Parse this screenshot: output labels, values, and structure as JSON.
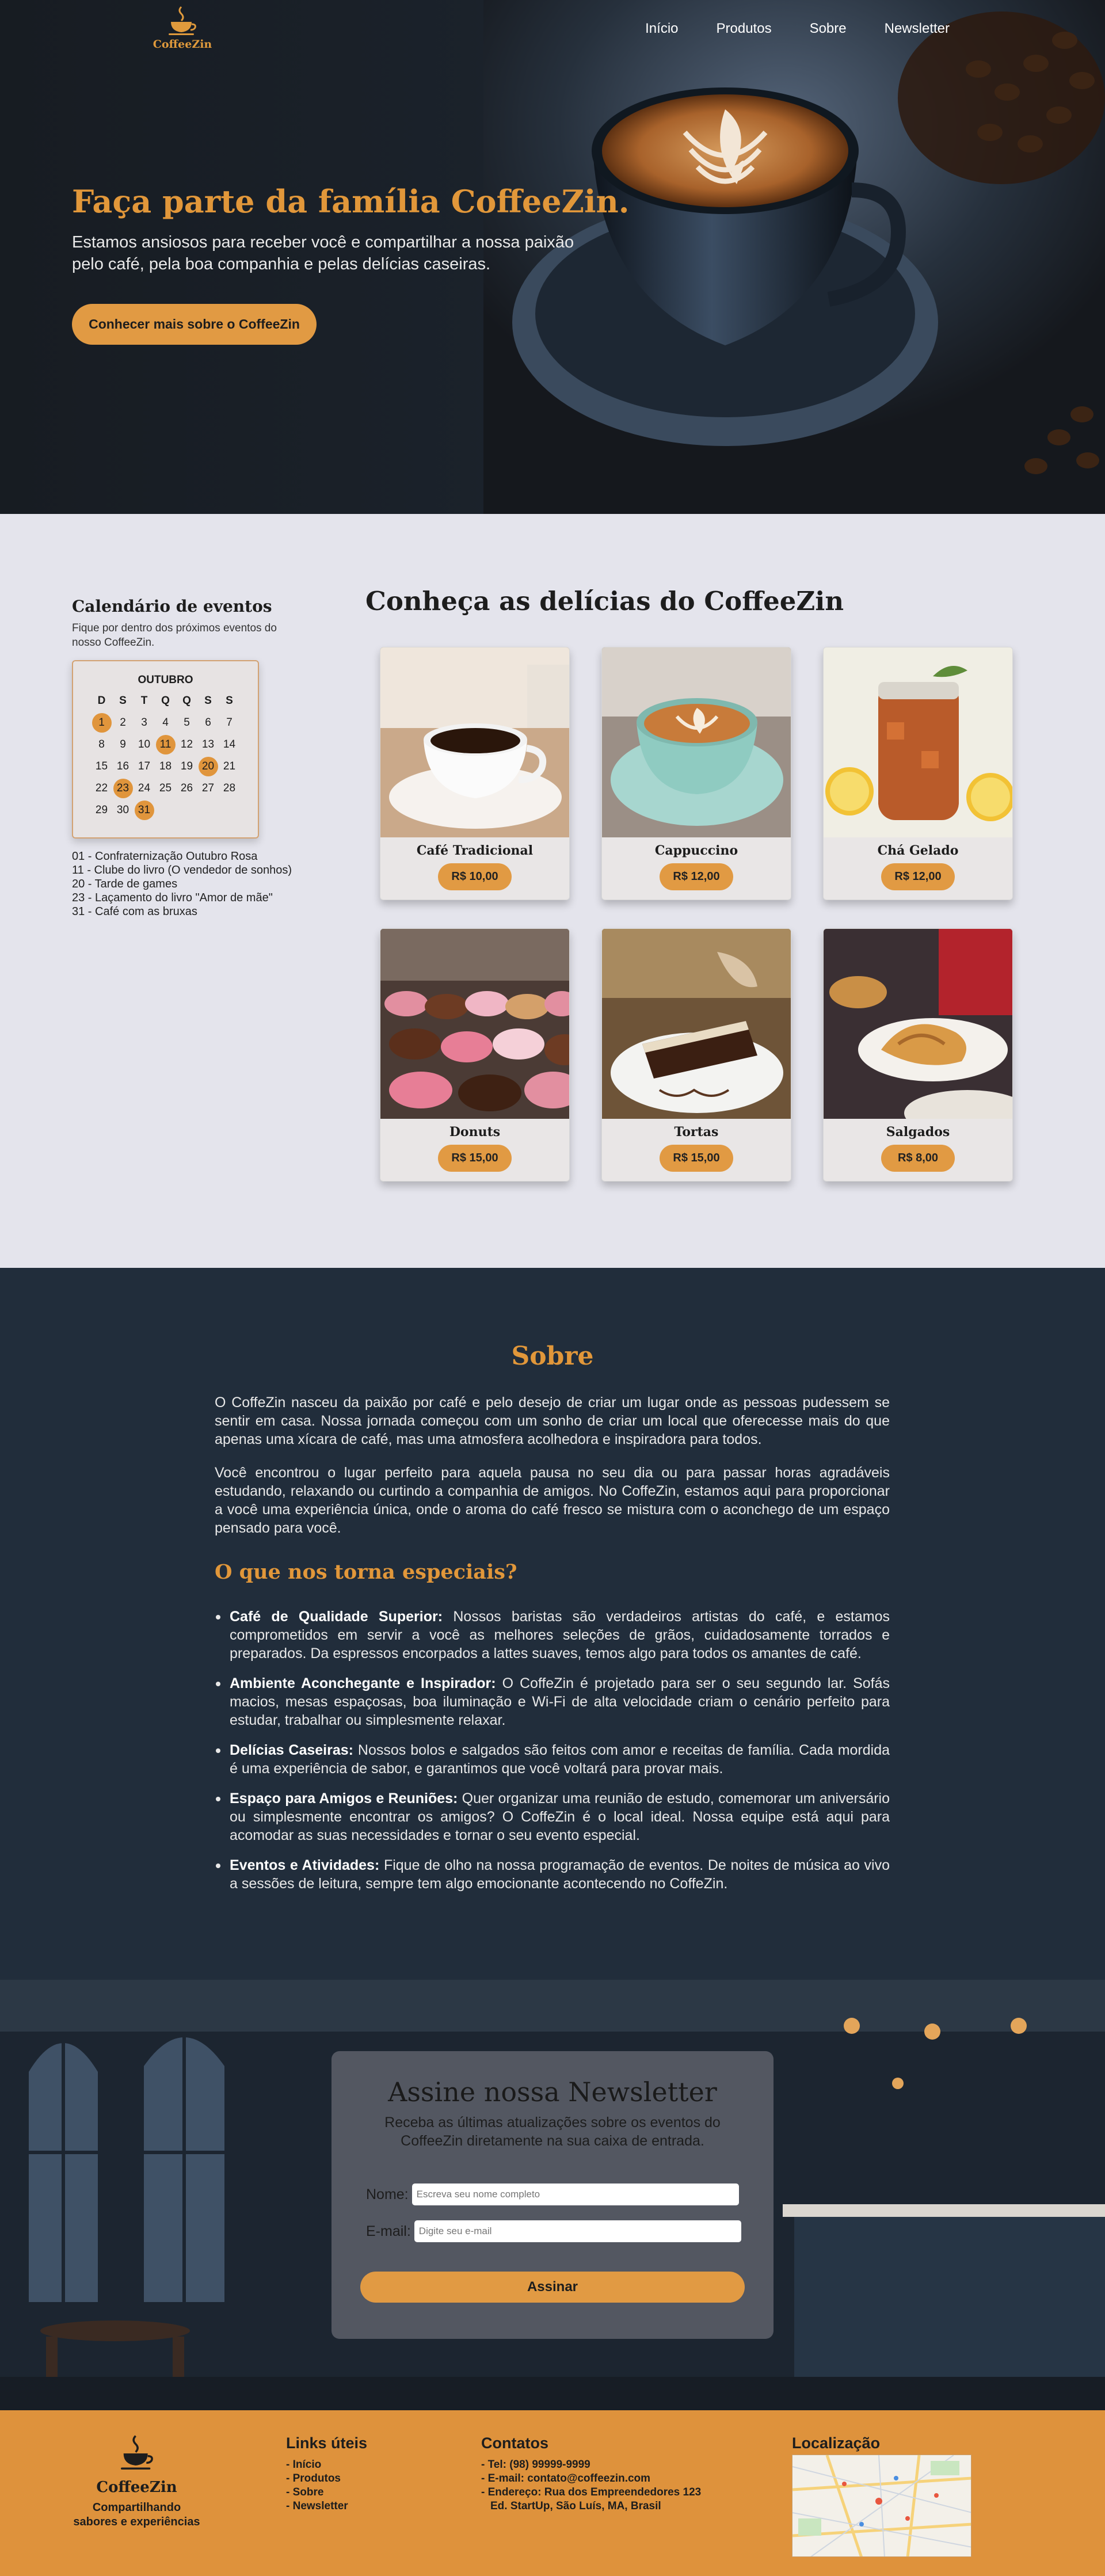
{
  "nav": {
    "brand": "CoffeeZin",
    "links": [
      "Início",
      "Produtos",
      "Sobre",
      "Newsletter"
    ]
  },
  "hero": {
    "title": "Faça parte da família CoffeeZin.",
    "subtitle": "Estamos ansiosos para receber você e compartilhar a nossa paixão pelo café, pela boa companhia e pelas delícias caseiras.",
    "button": "Conhecer mais sobre o CoffeeZin"
  },
  "calendar": {
    "title": "Calendário de eventos",
    "subtitle": "Fique por dentro dos próximos eventos do nosso CoffeeZin.",
    "month": "OUTUBRO",
    "weekdays": [
      "D",
      "S",
      "T",
      "Q",
      "Q",
      "S",
      "S"
    ],
    "days": [
      1,
      2,
      3,
      4,
      5,
      6,
      7,
      8,
      9,
      10,
      11,
      12,
      13,
      14,
      15,
      16,
      17,
      18,
      19,
      20,
      21,
      22,
      23,
      24,
      25,
      26,
      27,
      28,
      29,
      30,
      31
    ],
    "highlighted": [
      1,
      11,
      20,
      23,
      31
    ],
    "events": [
      "01 - Confraternização Outubro Rosa",
      "11 - Clube do livro (O vendedor de sonhos)",
      "20 - Tarde de games",
      "23 - Laçamento do livro \"Amor de mãe\"",
      "31 - Café com as bruxas"
    ]
  },
  "menu": {
    "title": "Conheça as delícias do CoffeeZin",
    "items": [
      {
        "name": "Café Tradicional",
        "price": "R$ 10,00"
      },
      {
        "name": "Cappuccino",
        "price": "R$ 12,00"
      },
      {
        "name": "Chá Gelado",
        "price": "R$ 12,00"
      },
      {
        "name": "Donuts",
        "price": "R$ 15,00"
      },
      {
        "name": "Tortas",
        "price": "R$ 15,00"
      },
      {
        "name": "Salgados",
        "price": "R$ 8,00"
      }
    ]
  },
  "about": {
    "title": "Sobre",
    "p1": "O CoffeZin nasceu da paixão por café e pelo desejo de criar um lugar onde as pessoas pudessem se sentir em casa. Nossa jornada começou com um sonho de criar um local que oferecesse mais do que apenas uma xícara de café, mas uma atmosfera acolhedora e inspiradora para todos.",
    "p2": "Você encontrou o lugar perfeito para aquela pausa no seu dia ou para passar horas agradáveis estudando, relaxando ou curtindo a companhia de amigos. No CoffeZin, estamos aqui para proporcionar a você uma experiência única, onde o aroma do café fresco se mistura com o aconchego de um espaço pensado para você.",
    "subtitle": "O que nos torna especiais?",
    "features": [
      {
        "title": "Café de Qualidade Superior:",
        "text": "Nossos baristas são verdadeiros artistas do café, e estamos comprometidos em servir a você as melhores seleções de grãos, cuidadosamente torrados e preparados. Da espressos encorpados a lattes suaves, temos algo para todos os amantes de café."
      },
      {
        "title": "Ambiente Aconchegante e Inspirador:",
        "text": "O CoffeZin é projetado para ser o seu segundo lar. Sofás macios, mesas espaçosas, boa iluminação e Wi-Fi de alta velocidade criam o cenário perfeito para estudar, trabalhar ou simplesmente relaxar."
      },
      {
        "title": "Delícias Caseiras:",
        "text": "Nossos bolos e salgados são feitos com amor e receitas de família. Cada mordida é uma experiência de sabor, e garantimos que você voltará para provar mais."
      },
      {
        "title": "Espaço para Amigos e Reuniões:",
        "text": "Quer organizar uma reunião de estudo, comemorar um aniversário ou simplesmente encontrar os amigos? O CoffeZin é o local ideal. Nossa equipe está aqui para acomodar as suas necessidades e tornar o seu evento especial."
      },
      {
        "title": "Eventos e Atividades:",
        "text": "Fique de olho na nossa programação de eventos. De noites de música ao vivo a sessões de leitura, sempre tem algo emocionante acontecendo no CoffeZin."
      }
    ]
  },
  "newsletter": {
    "title": "Assine nossa Newsletter",
    "subtitle": "Receba as últimas atualizações sobre os eventos do CoffeeZin diretamente na sua caixa de entrada.",
    "name_label": "Nome:",
    "name_placeholder": "Escreva seu nome completo",
    "email_label": "E-mail:",
    "email_placeholder": "Digite seu e-mail",
    "button": "Assinar"
  },
  "footer": {
    "brand": "CoffeeZin",
    "tagline": "Compartilhando sabores e experiências",
    "links_title": "Links úteis",
    "links": [
      "- Início",
      "- Produtos",
      "- Sobre",
      "- Newsletter"
    ],
    "contacts_title": "Contatos",
    "contacts": [
      "- Tel: (98) 99999-9999",
      "- E-mail: contato@coffeezin.com",
      "- Endereço: Rua dos Empreendedores 123",
      "Ed. StartUp, São Luís, MA, Brasil"
    ],
    "location_title": "Localização"
  },
  "colors": {
    "accent": "#e19a43",
    "dark": "#212d3b",
    "background": "#e4e4ec"
  }
}
